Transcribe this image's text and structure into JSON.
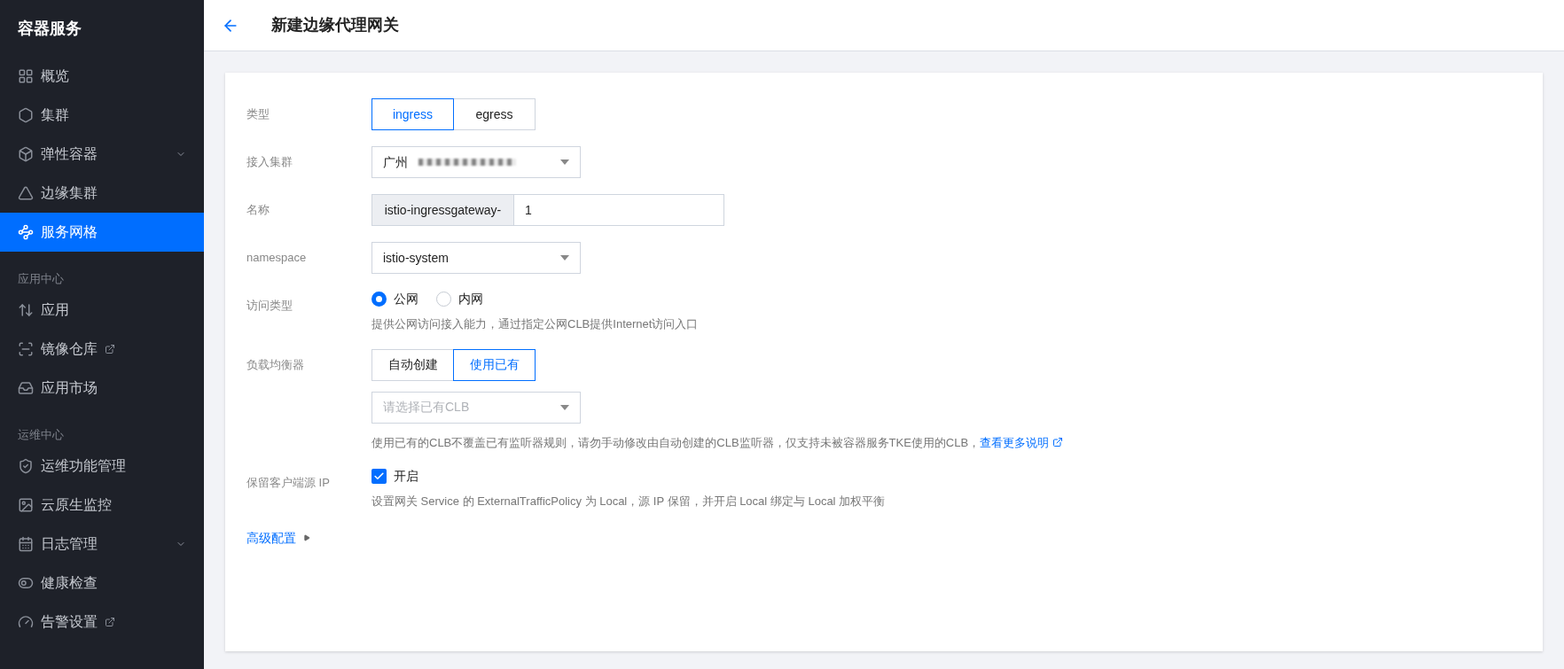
{
  "sidebar": {
    "title": "容器服务",
    "sections": [
      {
        "items": [
          {
            "label": "概览",
            "selected": false,
            "expandable": false,
            "external": false
          },
          {
            "label": "集群",
            "selected": false,
            "expandable": false,
            "external": false
          },
          {
            "label": "弹性容器",
            "selected": false,
            "expandable": true,
            "external": false
          },
          {
            "label": "边缘集群",
            "selected": false,
            "expandable": false,
            "external": false
          },
          {
            "label": "服务网格",
            "selected": true,
            "expandable": false,
            "external": false
          }
        ]
      },
      {
        "heading": "应用中心",
        "items": [
          {
            "label": "应用",
            "selected": false,
            "expandable": false,
            "external": false
          },
          {
            "label": "镜像仓库",
            "selected": false,
            "expandable": false,
            "external": true
          },
          {
            "label": "应用市场",
            "selected": false,
            "expandable": false,
            "external": false
          }
        ]
      },
      {
        "heading": "运维中心",
        "items": [
          {
            "label": "运维功能管理",
            "selected": false,
            "expandable": false,
            "external": false
          },
          {
            "label": "云原生监控",
            "selected": false,
            "expandable": false,
            "external": false
          },
          {
            "label": "日志管理",
            "selected": false,
            "expandable": true,
            "external": false
          },
          {
            "label": "健康检查",
            "selected": false,
            "expandable": false,
            "external": false
          },
          {
            "label": "告警设置",
            "selected": false,
            "expandable": false,
            "external": true
          }
        ]
      }
    ]
  },
  "header": {
    "title": "新建边缘代理网关"
  },
  "form": {
    "rows": [
      {
        "label": "类型",
        "kind": "segmented",
        "options": [
          {
            "label": "ingress",
            "selected": true
          },
          {
            "label": "egress",
            "selected": false
          }
        ]
      },
      {
        "label": "接入集群",
        "kind": "select",
        "value": "广州",
        "redacted": true
      },
      {
        "label": "名称",
        "kind": "prefixed-input",
        "prefix": "istio-ingressgateway-",
        "value": "1"
      },
      {
        "label": "namespace",
        "kind": "select",
        "value": "istio-system"
      },
      {
        "label": "访问类型",
        "kind": "radio",
        "options": [
          {
            "label": "公网",
            "selected": true
          },
          {
            "label": "内网",
            "selected": false
          }
        ],
        "hint": "提供公网访问接入能力，通过指定公网CLB提供Internet访问入口"
      },
      {
        "label": "负载均衡器",
        "kind": "segmented-select",
        "options": [
          {
            "label": "自动创建",
            "selected": false
          },
          {
            "label": "使用已有",
            "selected": true
          }
        ],
        "placeholder": "请选择已有CLB",
        "hint": "使用已有的CLB不覆盖已有监听器规则，请勿手动修改由自动创建的CLB监听器，仅支持未被容器服务TKE使用的CLB，",
        "link": "查看更多说明"
      },
      {
        "label": "保留客户端源 IP",
        "kind": "checkbox",
        "checked": true,
        "text": "开启",
        "hint": "设置网关 Service 的 ExternalTrafficPolicy 为 Local，源 IP 保留，并开启 Local 绑定与 Local 加权平衡"
      }
    ],
    "advanced": "高级配置"
  }
}
